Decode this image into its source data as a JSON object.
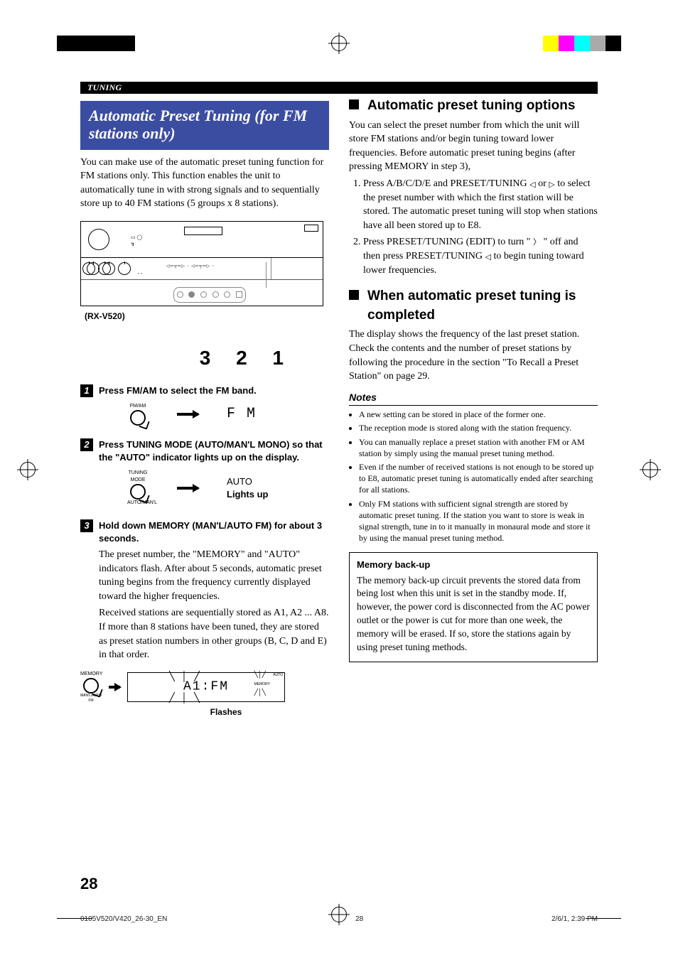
{
  "section_tab": "TUNING",
  "left": {
    "title": "Automatic Preset Tuning (for FM stations only)",
    "intro": "You can make use of the automatic preset tuning function for FM stations only. This function enables the unit to automatically tune in with strong signals and to sequentially store up to 40 FM stations (5 groups x 8 stations).",
    "model": "(RX-V520)",
    "callouts": "3  2 1",
    "steps": {
      "s1": {
        "head": "Press FM/AM to select the FM band.",
        "btn": "FM/AM",
        "result": "F M"
      },
      "s2": {
        "head": "Press TUNING MODE (AUTO/MAN'L MONO) so that the \"AUTO\" indicator lights up on the display.",
        "btn_top": "TUNING MODE",
        "btn_bot": "AUTO/MAN'L",
        "result_top": "AUTO",
        "result_bot": "Lights up"
      },
      "s3": {
        "head": "Hold down MEMORY (MAN'L/AUTO FM) for about 3 seconds.",
        "body1": "The preset number, the \"MEMORY\" and \"AUTO\" indicators flash. After about 5 seconds, automatic preset tuning begins from the frequency currently displayed toward the higher frequencies.",
        "body2": "Received stations are sequentially stored as A1, A2 ... A8. If more than 8 stations have been tuned, they are stored as preset station numbers in other groups (B, C, D and E) in that order.",
        "btn_top": "MEMORY",
        "btn_bot": "MAN'L/AUTO FM",
        "disp_center": "A1:FM",
        "disp_memory": "MEMORY",
        "disp_auto": "AUTO",
        "flashes": "Flashes"
      }
    }
  },
  "right": {
    "h1": "Automatic preset tuning options",
    "p1": "You can select the preset number from which the unit will store FM stations and/or begin tuning toward lower frequencies. Before automatic preset tuning begins (after pressing MEMORY in step 3),",
    "li1a": "Press A/B/C/D/E and PRESET/TUNING ",
    "li1b": " or ",
    "li1c": " to select the preset number with which the first station will be stored. The automatic preset tuning will stop when stations have all been stored up to E8.",
    "li2a": "Press PRESET/TUNING (EDIT) to turn \" ",
    "li2b": " \" off and then press PRESET/TUNING ",
    "li2c": " to begin tuning toward lower frequencies.",
    "h2": "When automatic preset tuning is completed",
    "p2": "The display shows the frequency of the last preset station. Check the contents and the number of preset stations by following the procedure in the section \"To Recall a Preset Station\" on page 29.",
    "notes_head": "Notes",
    "n1": "A new setting can be stored in place of the former one.",
    "n2": "The reception mode is stored along with the station frequency.",
    "n3": "You can manually replace a preset station with another FM or AM station by simply using the manual preset tuning method.",
    "n4": "Even if the number of received stations is not enough to be stored up to E8, automatic preset tuning is automatically ended after searching for all stations.",
    "n5": "Only FM stations with sufficient signal strength are stored by automatic preset tuning. If the station you want to store is weak in signal strength, tune in to it manually in monaural mode and store it by using the manual preset tuning method.",
    "mb_head": "Memory back-up",
    "mb_body": "The memory back-up circuit prevents the stored data from being lost when this unit is set in the standby mode. If, however, the power cord is disconnected from the AC power outlet or the power is cut for more than one week, the memory will be erased. If so, store the stations again by using preset tuning methods."
  },
  "page_num": "28",
  "footer": {
    "left": "0105V520/V420_26-30_EN",
    "center": "28",
    "right": "2/6/1, 2:39 PM"
  }
}
